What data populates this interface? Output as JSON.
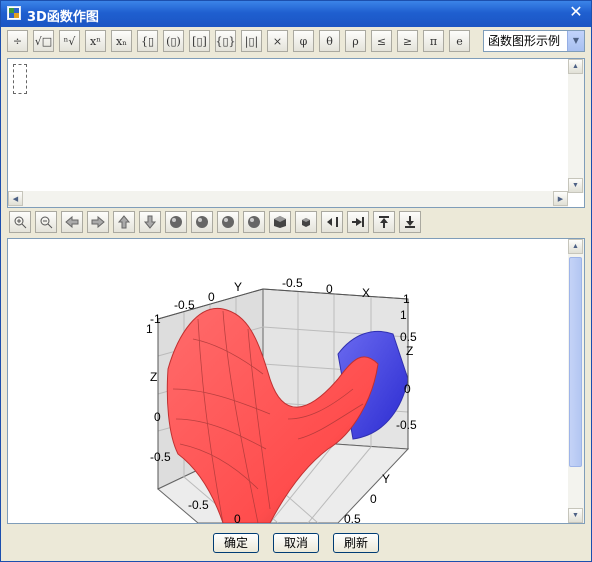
{
  "window": {
    "title": "3D函数作图",
    "close": "✕"
  },
  "toolbar": {
    "buttons": [
      {
        "name": "fraction-button",
        "icon": "fraction-icon",
        "glyph": "÷"
      },
      {
        "name": "sqrt-button",
        "icon": "sqrt-icon",
        "glyph": "√□"
      },
      {
        "name": "nth-root-button",
        "icon": "nth-root-icon",
        "glyph": "ⁿ√"
      },
      {
        "name": "superscript-button",
        "icon": "superscript-icon",
        "glyph": "xⁿ"
      },
      {
        "name": "subscript-button",
        "icon": "subscript-icon",
        "glyph": "xₙ"
      },
      {
        "name": "braces-button",
        "icon": "braces-icon",
        "glyph": "{▯"
      },
      {
        "name": "parentheses-button",
        "icon": "parentheses-icon",
        "glyph": "(▯)"
      },
      {
        "name": "brackets-button",
        "icon": "brackets-icon",
        "glyph": "[▯]"
      },
      {
        "name": "curly-braces-button",
        "icon": "curly-braces-icon",
        "glyph": "{▯}"
      },
      {
        "name": "abs-button",
        "icon": "abs-icon",
        "glyph": "|▯|"
      },
      {
        "name": "times-button",
        "icon": "times-icon",
        "glyph": "×"
      },
      {
        "name": "phi-button",
        "icon": "phi-icon",
        "glyph": "φ"
      },
      {
        "name": "theta-button",
        "icon": "theta-icon",
        "glyph": "θ"
      },
      {
        "name": "rho-button",
        "icon": "rho-icon",
        "glyph": "ρ"
      },
      {
        "name": "leq-button",
        "icon": "leq-icon",
        "glyph": "≤"
      },
      {
        "name": "geq-button",
        "icon": "geq-icon",
        "glyph": "≥"
      },
      {
        "name": "pi-button",
        "icon": "pi-icon",
        "glyph": "π"
      },
      {
        "name": "e-button",
        "icon": "e-icon",
        "glyph": "e"
      }
    ],
    "example_select": {
      "value": "函数图形示例"
    }
  },
  "view_toolbar": {
    "buttons": [
      {
        "name": "zoom-in-button",
        "icon": "zoom-in-icon"
      },
      {
        "name": "zoom-out-button",
        "icon": "zoom-out-icon"
      },
      {
        "name": "rotate-left-button",
        "icon": "arrow-left-icon"
      },
      {
        "name": "rotate-right-button",
        "icon": "arrow-right-icon"
      },
      {
        "name": "rotate-up-button",
        "icon": "arrow-up-icon"
      },
      {
        "name": "rotate-down-button",
        "icon": "arrow-down-icon"
      },
      {
        "name": "view-1-button",
        "icon": "sphere-icon"
      },
      {
        "name": "view-2-button",
        "icon": "sphere-icon"
      },
      {
        "name": "view-3-button",
        "icon": "sphere-icon"
      },
      {
        "name": "view-4-button",
        "icon": "sphere-icon"
      },
      {
        "name": "cube-large-button",
        "icon": "cube-icon"
      },
      {
        "name": "cube-small-button",
        "icon": "cube-small-icon"
      },
      {
        "name": "move-left-button",
        "icon": "collapse-left-icon"
      },
      {
        "name": "move-right-button",
        "icon": "collapse-right-icon"
      },
      {
        "name": "move-top-button",
        "icon": "to-top-icon"
      },
      {
        "name": "move-bottom-button",
        "icon": "to-bottom-icon"
      }
    ]
  },
  "plot": {
    "surface": "saddle",
    "colors": {
      "front": "#ff5a5a",
      "back": "#4a4ae6",
      "grid": "#c8c8c8",
      "box": "#555555"
    },
    "labels": {
      "x_axis": "X",
      "y_axis_top": "Y",
      "y_axis_right": "Y",
      "z_axis_left": "Z",
      "z_axis_right": "Z",
      "top_ticks": [
        "-1",
        "-0.5",
        "0",
        "-0.5",
        "0",
        "1"
      ],
      "left_ticks": [
        "1",
        "0",
        "-0.5"
      ],
      "right_ticks": [
        "1",
        "0.5",
        "0",
        "-0.5"
      ],
      "bottom_ticks": [
        "-0.5",
        "0",
        "0",
        "0.5"
      ]
    }
  },
  "buttons": {
    "ok": "确定",
    "cancel": "取消",
    "refresh": "刷新"
  }
}
